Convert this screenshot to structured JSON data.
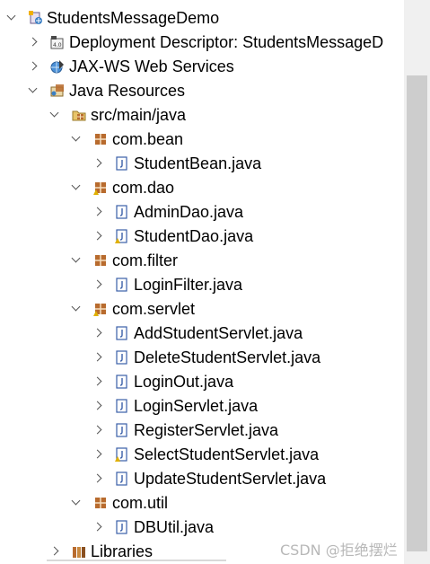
{
  "tree": {
    "project": "StudentsMessageDemo",
    "deployment_descriptor": "Deployment Descriptor: StudentsMessageD",
    "jaxws": "JAX-WS Web Services",
    "java_resources": "Java Resources",
    "src_folder": "src/main/java",
    "pkg_bean": "com.bean",
    "file_studentbean": "StudentBean.java",
    "pkg_dao": "com.dao",
    "file_admindao": "AdminDao.java",
    "file_studentdao": "StudentDao.java",
    "pkg_filter": "com.filter",
    "file_loginfilter": "LoginFilter.java",
    "pkg_servlet": "com.servlet",
    "file_addstudentservlet": "AddStudentServlet.java",
    "file_deletestudentservlet": "DeleteStudentServlet.java",
    "file_loginout": "LoginOut.java",
    "file_loginservlet": "LoginServlet.java",
    "file_registerservlet": "RegisterServlet.java",
    "file_selectstudentservlet": "SelectStudentServlet.java",
    "file_updatestudentservlet": "UpdateStudentServlet.java",
    "pkg_util": "com.util",
    "file_dbutil": "DBUtil.java",
    "libraries": "Libraries"
  },
  "watermark": "CSDN @拒绝摆烂",
  "colors": {
    "package_icon": "#b86b2e",
    "java_file_icon": "#3a5fa8",
    "warning_icon": "#e0b000",
    "scrollbar_thumb": "#cdcdcd"
  }
}
